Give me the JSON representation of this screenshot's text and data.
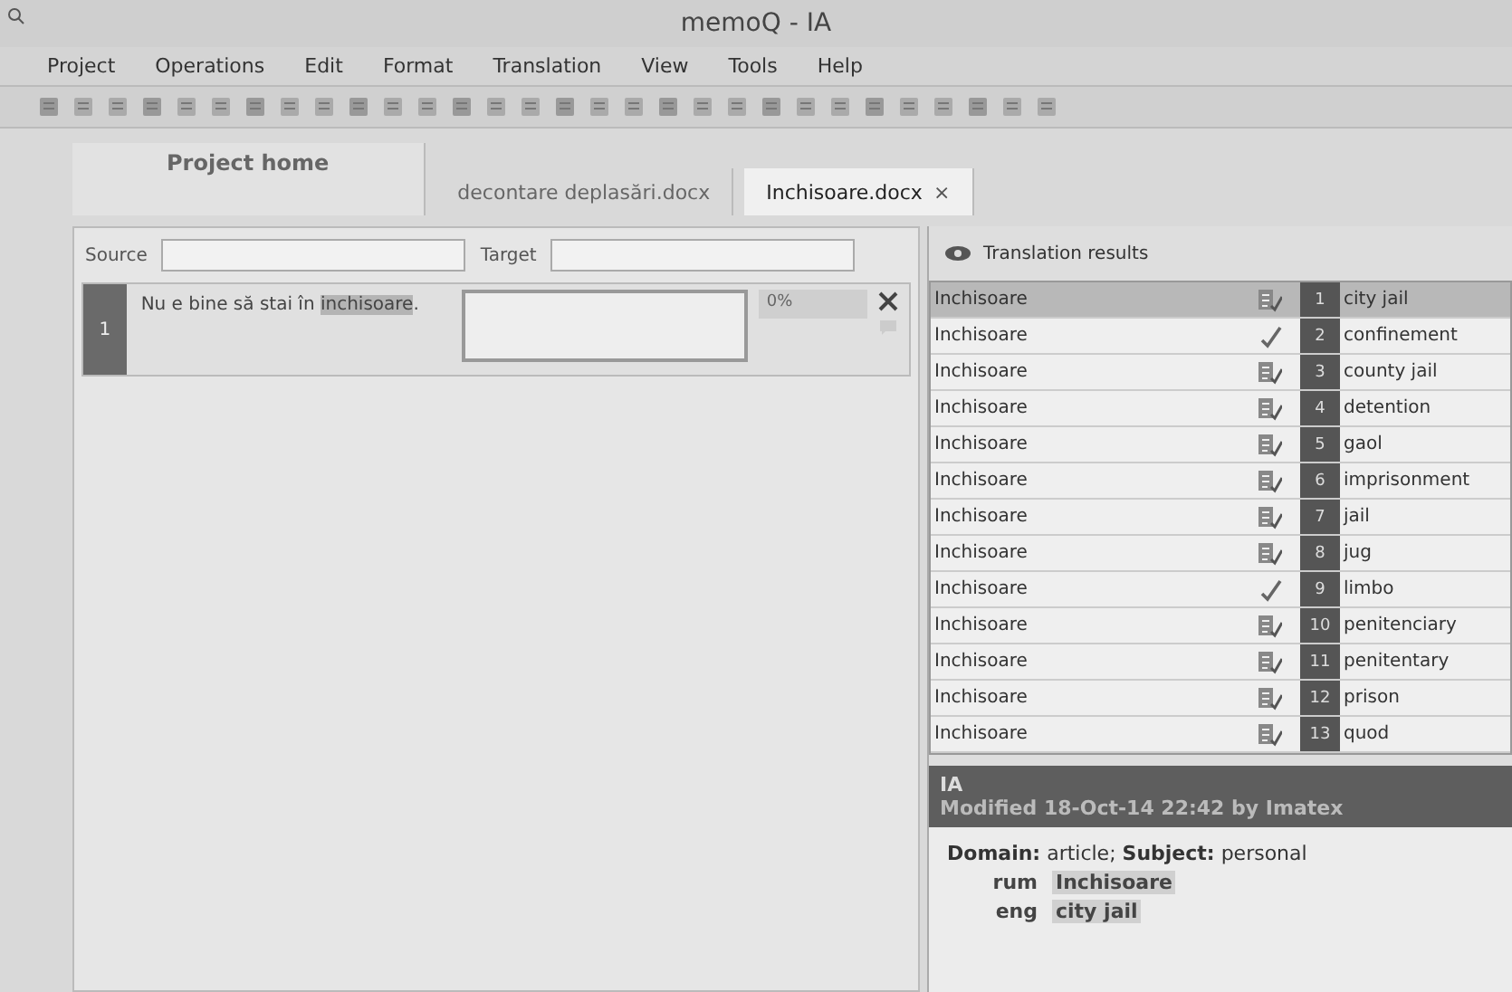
{
  "window": {
    "title": "memoQ - IA"
  },
  "menu": [
    "Project",
    "Operations",
    "Edit",
    "Format",
    "Translation",
    "View",
    "Tools",
    "Help"
  ],
  "tabs": [
    {
      "label": "Project home",
      "selected": false
    },
    {
      "label": "decontare deplasări.docx",
      "selected": false
    },
    {
      "label": "Inchisoare.docx",
      "selected": true,
      "close": "×"
    }
  ],
  "filter": {
    "source_label": "Source",
    "target_label": "Target"
  },
  "segments": [
    {
      "number": "1",
      "source_before": "Nu e bine să stai în ",
      "source_term": "inchisoare",
      "source_after": ".",
      "match": "0%",
      "selected": true
    }
  ],
  "results": {
    "title": "Translation results",
    "rows": [
      {
        "source": "Inchisoare",
        "number": "1",
        "target": "city jail",
        "selected": true,
        "kind": "term"
      },
      {
        "source": "Inchisoare",
        "number": "2",
        "target": "confinement",
        "selected": false,
        "kind": "check"
      },
      {
        "source": "Inchisoare",
        "number": "3",
        "target": "county jail",
        "selected": false,
        "kind": "term"
      },
      {
        "source": "Inchisoare",
        "number": "4",
        "target": "detention",
        "selected": false,
        "kind": "term"
      },
      {
        "source": "Inchisoare",
        "number": "5",
        "target": "gaol",
        "selected": false,
        "kind": "term"
      },
      {
        "source": "Inchisoare",
        "number": "6",
        "target": "imprisonment",
        "selected": false,
        "kind": "term"
      },
      {
        "source": "Inchisoare",
        "number": "7",
        "target": "jail",
        "selected": false,
        "kind": "term"
      },
      {
        "source": "Inchisoare",
        "number": "8",
        "target": "jug",
        "selected": false,
        "kind": "term"
      },
      {
        "source": "Inchisoare",
        "number": "9",
        "target": "limbo",
        "selected": false,
        "kind": "check"
      },
      {
        "source": "Inchisoare",
        "number": "10",
        "target": "penitenciary",
        "selected": false,
        "kind": "term"
      },
      {
        "source": "Inchisoare",
        "number": "11",
        "target": "penitentary",
        "selected": false,
        "kind": "term"
      },
      {
        "source": "Inchisoare",
        "number": "12",
        "target": "prison",
        "selected": false,
        "kind": "term"
      },
      {
        "source": "Inchisoare",
        "number": "13",
        "target": "quod",
        "selected": false,
        "kind": "term"
      }
    ]
  },
  "details": {
    "name": "IA",
    "modified": "Modified 18-Oct-14 22:42 by Imatex",
    "meta": "**Domain:** article; **Subject:** personal",
    "terms": [
      {
        "lang": "rum",
        "term": "Inchisoare"
      },
      {
        "lang": "eng",
        "term": "city jail"
      }
    ]
  }
}
